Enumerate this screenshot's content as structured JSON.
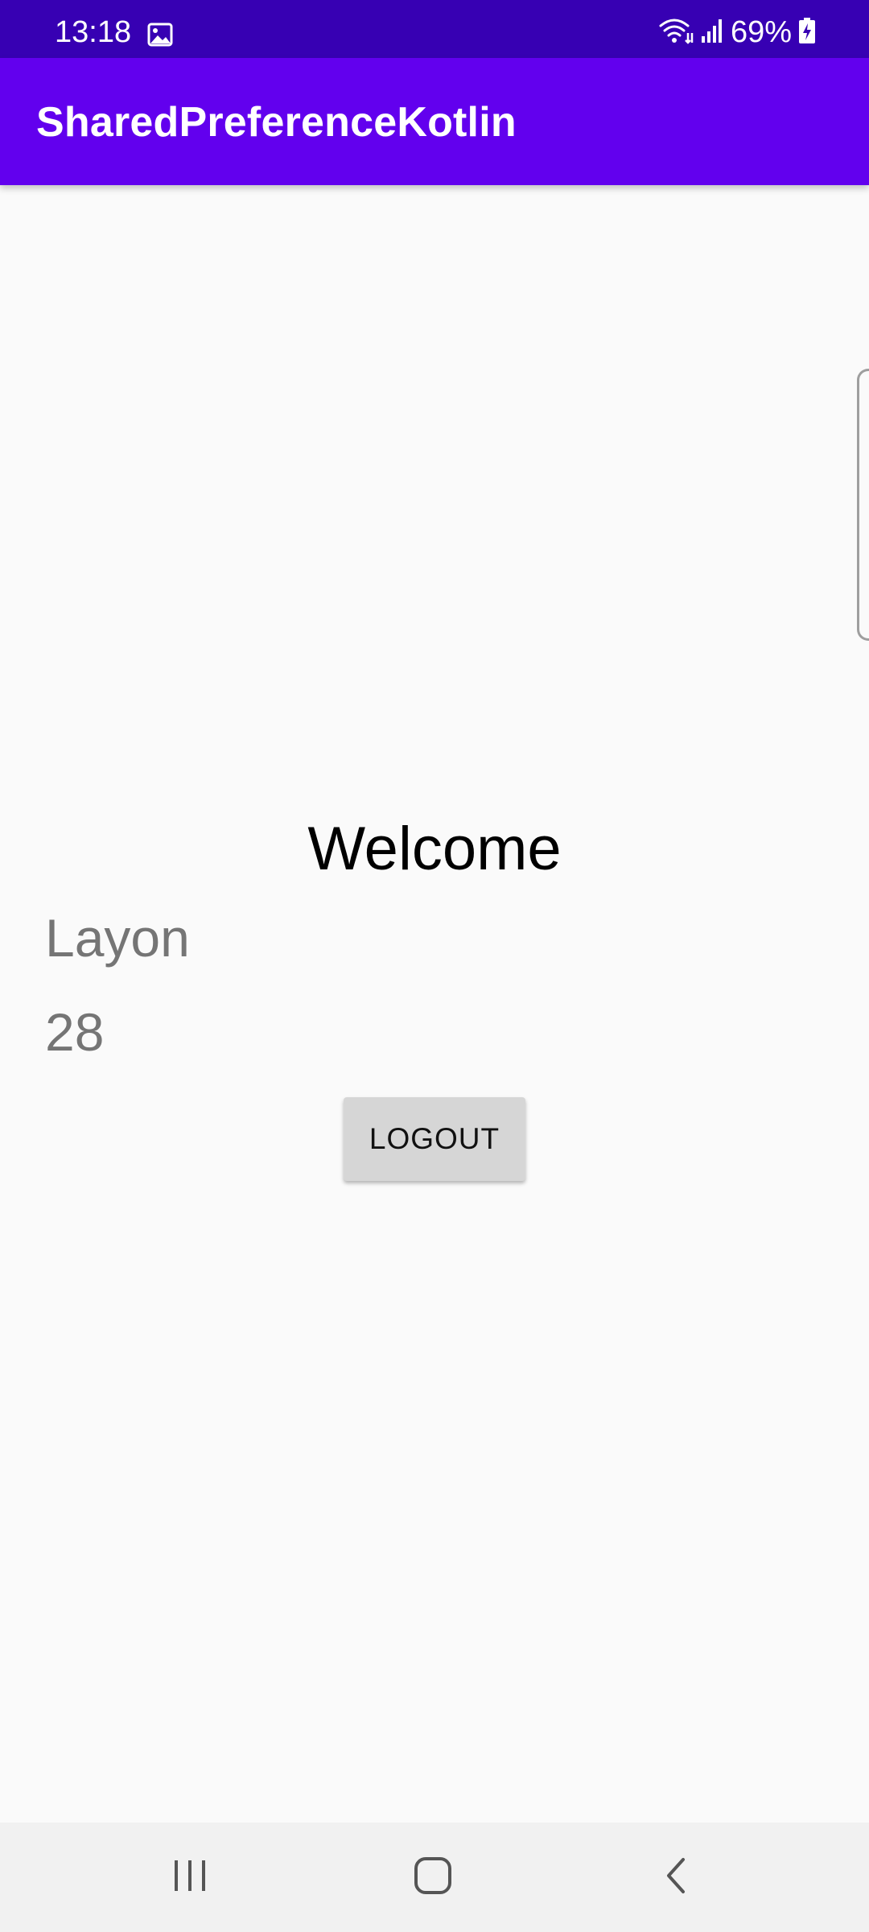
{
  "status_bar": {
    "time": "13:18",
    "battery_percent": "69%",
    "icons": [
      "image-icon",
      "wifi-icon",
      "signal-icon",
      "battery-charging-icon"
    ]
  },
  "app_bar": {
    "title": "SharedPreferenceKotlin"
  },
  "main": {
    "welcome": "Welcome",
    "name": "Layon",
    "age": "28",
    "logout_label": "LOGOUT"
  },
  "nav_bar": {
    "icons": [
      "recents-icon",
      "home-icon",
      "back-icon"
    ]
  },
  "colors": {
    "status_bar": "#3700b3",
    "primary": "#6200ee",
    "background": "#fafafa",
    "button": "#d6d6d6",
    "secondary_text": "#757575"
  }
}
